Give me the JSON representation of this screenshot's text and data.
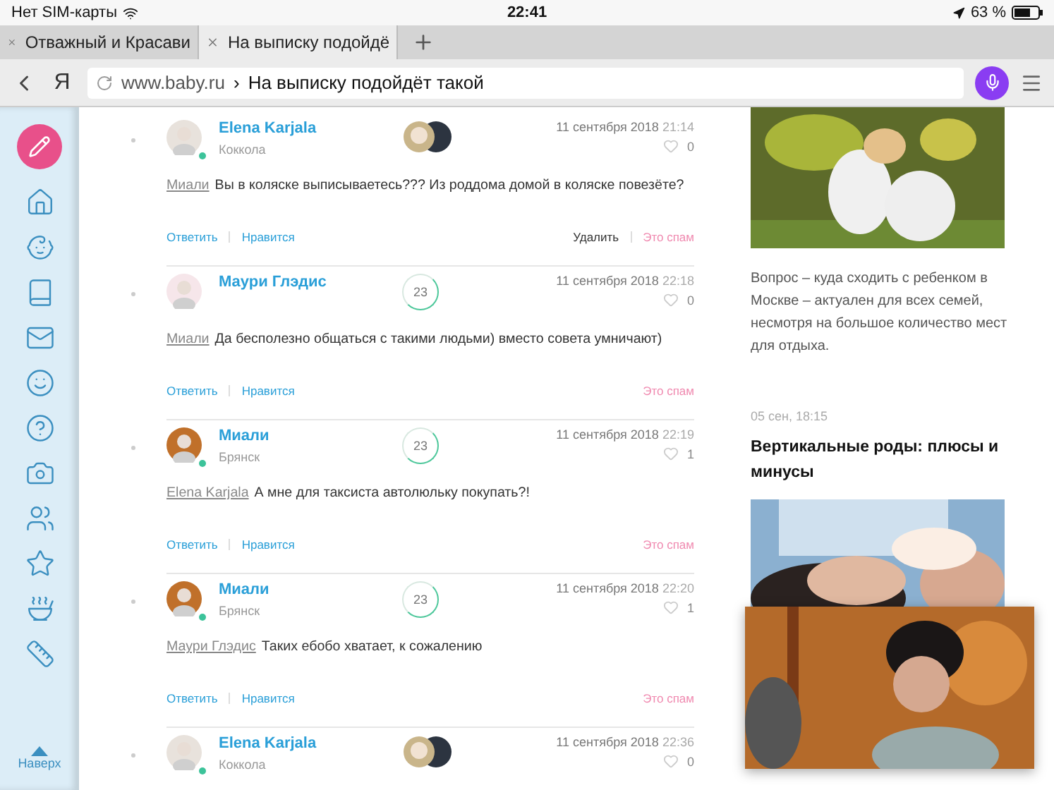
{
  "status_bar": {
    "carrier": "Нет SIM-карты",
    "time": "22:41",
    "battery": "63 %"
  },
  "browser": {
    "tabs": [
      {
        "label": "Отважный и Красави",
        "selected": false
      },
      {
        "label": "На выписку подойдё",
        "selected": true
      }
    ],
    "logo": "Я",
    "address": {
      "domain": "www.baby.ru",
      "separator": "›",
      "title": "На выписку подойдёт такой"
    }
  },
  "sidebar": {
    "top_link": "Наверх"
  },
  "comments": [
    {
      "author": "Elena Karjala",
      "city": "Коккола",
      "online": true,
      "badge": {
        "kind": "photos"
      },
      "date": "11 сентября 2018",
      "time": "21:14",
      "likes": "0",
      "mention": "Миали",
      "text": "Вы в коляске выписываетесь??? Из роддома домой в коляске повезёте?",
      "actions": [
        "Ответить",
        "Нравится"
      ],
      "admin_actions": [
        {
          "label": "Удалить",
          "kind": "delete"
        },
        {
          "label": "Это спам",
          "kind": "spam"
        }
      ]
    },
    {
      "author": "Маури Глэдис",
      "online": false,
      "badge": {
        "kind": "count",
        "label": "23"
      },
      "date": "11 сентября 2018",
      "time": "22:18",
      "likes": "0",
      "mention": "Миали",
      "text": "Да бесполезно общаться с такими людьми) вместо совета умничают)",
      "actions": [
        "Ответить",
        "Нравится"
      ],
      "admin_actions": [
        {
          "label": "Это спам",
          "kind": "spam"
        }
      ]
    },
    {
      "author": "Миали",
      "city": "Брянск",
      "online": true,
      "badge": {
        "kind": "count",
        "label": "23"
      },
      "date": "11 сентября 2018",
      "time": "22:19",
      "likes": "1",
      "mention": "Elena Karjala",
      "text": "А мне для таксиста автолюльку покупать?!",
      "actions": [
        "Ответить",
        "Нравится"
      ],
      "admin_actions": [
        {
          "label": "Это спам",
          "kind": "spam"
        }
      ]
    },
    {
      "author": "Миали",
      "city": "Брянск",
      "online": true,
      "badge": {
        "kind": "count",
        "label": "23"
      },
      "date": "11 сентября 2018",
      "time": "22:20",
      "likes": "1",
      "mention": "Маури Глэдис",
      "text": "Таких ебобо хватает, к сожалению",
      "actions": [
        "Ответить",
        "Нравится"
      ],
      "admin_actions": [
        {
          "label": "Это спам",
          "kind": "spam"
        }
      ]
    },
    {
      "author": "Elena Karjala",
      "city": "Коккола",
      "online": true,
      "badge": {
        "kind": "photos"
      },
      "date": "11 сентября 2018",
      "time": "22:36",
      "likes": "0"
    }
  ],
  "feed": [
    {
      "kind": "picture"
    },
    {
      "kind": "text",
      "text": "Вопрос – куда сходить с ребенком в Москве – актуален для всех семей, несмотря на большое количество мест для отдыха."
    },
    {
      "kind": "date",
      "text": "05 сен, 18:15"
    },
    {
      "kind": "headline",
      "text": "Вертикальные роды: плюсы и минусы"
    },
    {
      "kind": "picture"
    }
  ],
  "video": {
    "kind": "picture"
  }
}
